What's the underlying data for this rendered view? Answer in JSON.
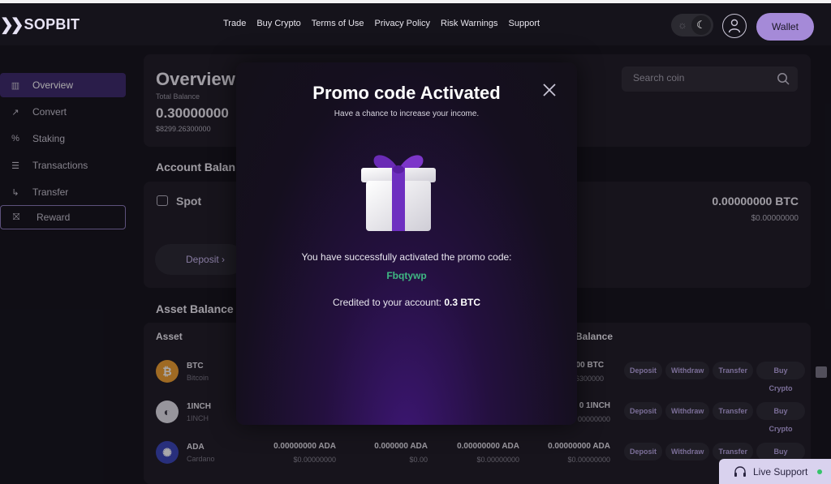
{
  "brand": {
    "name": "SOPBIT"
  },
  "nav": {
    "items": [
      "Trade",
      "Buy Crypto",
      "Terms of Use",
      "Privacy Policy",
      "Risk Warnings",
      "Support"
    ]
  },
  "header": {
    "wallet_label": "Wallet",
    "theme_icon": "moon-icon",
    "avatar_icon": "user-icon"
  },
  "sidebar": {
    "items": [
      {
        "label": "Overview",
        "icon": "chart-icon",
        "active": true
      },
      {
        "label": "Convert",
        "icon": "convert-icon"
      },
      {
        "label": "Staking",
        "icon": "percent-icon"
      },
      {
        "label": "Transactions",
        "icon": "list-icon"
      },
      {
        "label": "Transfer",
        "icon": "transfer-icon"
      },
      {
        "label": "Reward",
        "icon": "gift-icon"
      }
    ]
  },
  "overview": {
    "title": "Overview",
    "total_label": "Total Balance",
    "total_value": "0.30000000",
    "total_usd": "$8299.26300000"
  },
  "search": {
    "placeholder": "Search coin"
  },
  "account": {
    "title": "Account Balan",
    "spot_label": "Spot",
    "spot_btc": "0.00000000 BTC",
    "spot_usd": "$0.00000000",
    "deposit_label": "Deposit"
  },
  "assets": {
    "title": "Asset Balance",
    "header_asset": "Asset",
    "header_balance": "Balance",
    "rows": [
      {
        "symbol": "BTC",
        "name": "Bitcoin",
        "color": "#f0a030",
        "glyph": "₿",
        "visible_balance": "000 BTC",
        "visible_usd": "26300000"
      },
      {
        "symbol": "1INCH",
        "name": "1INCH",
        "color": "#e4e2ea",
        "glyph": "◐",
        "visible_balance": "0 1INCH",
        "visible_usd": "00000000"
      },
      {
        "symbol": "ADA",
        "name": "Cardano",
        "color": "#3a45b8",
        "glyph": "✺",
        "cells": [
          {
            "value": "0.00000000 ADA",
            "usd": "$0.00000000"
          },
          {
            "value": "0.000000 ADA",
            "usd": "$0.00"
          },
          {
            "value": "0.00000000 ADA",
            "usd": "$0.00000000"
          },
          {
            "value": "0.00000000 ADA",
            "usd": "$0.00000000"
          }
        ]
      }
    ],
    "actions": [
      "Deposit",
      "Withdraw",
      "Transfer",
      "Buy Crypto"
    ]
  },
  "modal": {
    "title": "Promo code Activated",
    "subtitle": "Have a chance to increase your income.",
    "message": "You have successfully activated the promo code:",
    "code": "Fbqtywp",
    "credit_prefix": "Credited to your account:",
    "credit_amount": "0.3 BTC",
    "code_color": "#3fb883"
  },
  "support": {
    "label": "Live Support"
  }
}
